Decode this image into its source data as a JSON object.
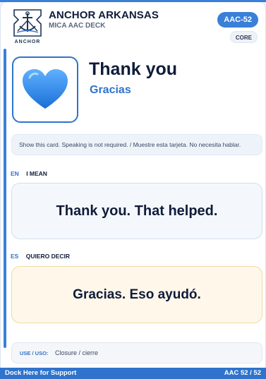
{
  "header": {
    "logo_text": "ANCHOR",
    "org_name": "ANCHOR ARKANSAS",
    "deck_name": "MICA AAC DECK",
    "card_id": "AAC-52",
    "category": "CORE"
  },
  "hero": {
    "symbol_icon": "blue-heart-icon",
    "title_en": "Thank you",
    "title_es": "Gracias"
  },
  "hint": "Show this card. Speaking is not required. / Muestre esta tarjeta. No necesita hablar.",
  "english": {
    "code": "EN",
    "label": "I MEAN",
    "phrase": "Thank you. That helped."
  },
  "spanish": {
    "code": "ES",
    "label": "QUIERO DECIR",
    "phrase": "Gracias. Eso ayudó."
  },
  "use": {
    "label": "USE / USO:",
    "value": "Closure / cierre"
  },
  "footer": {
    "left": "Dock Here for Support",
    "right": "AAC 52 / 52"
  },
  "colors": {
    "accent": "#2f73cc",
    "text": "#0f1c3a",
    "es_background": "#fff8ea",
    "es_border": "#efd9a6"
  }
}
